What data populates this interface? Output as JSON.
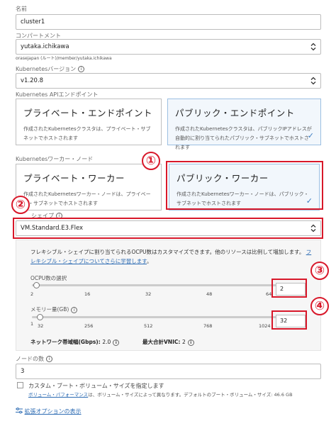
{
  "name": {
    "label": "名前",
    "value": "cluster1"
  },
  "compartment": {
    "label": "コンパートメント",
    "value": "yutaka.ichikawa",
    "path": "orasejapan (ルート)/member/yutaka.ichikawa"
  },
  "k8s_version": {
    "label": "Kubernetesバージョン",
    "value": "v1.20.8"
  },
  "api_endpoint": {
    "label": "Kubernetes APIエンドポイント",
    "options": [
      {
        "title": "プライベート・エンドポイント",
        "desc": "作成されたKubernetesクラスタは、プライベート・サブネットでホストされます",
        "selected": false
      },
      {
        "title": "パブリック・エンドポイント",
        "desc": "作成されたKubernetesクラスタは、パブリックIPアドレスが自動的に割り当てられたパブリック・サブネットでホストされます",
        "selected": true
      }
    ]
  },
  "worker_nodes": {
    "label": "Kubernetesワーカー・ノード",
    "options": [
      {
        "title": "プライベート・ワーカー",
        "desc": "作成されたKubernetesワーカー・ノードは、プライベート・サブネットでホストされます",
        "selected": false
      },
      {
        "title": "パブリック・ワーカー",
        "desc": "作成されたKubernetesワーカー・ノードは、パブリック・サブネットでホストされます",
        "selected": true
      }
    ]
  },
  "shape": {
    "label": "シェイプ",
    "value": "VM.Standard.E3.Flex"
  },
  "flex": {
    "desc": "フレキシブル・シェイプに割り当てられるOCPU数はカスタマイズできます。他のリソースは比例して増加します。",
    "link": "フレキシブル・シェイプについてさらに学習します",
    "period": "。",
    "ocpu": {
      "label": "OCPU数の選択",
      "ticks": [
        "1",
        "16",
        "32",
        "48",
        "64"
      ],
      "start_tick": "2",
      "value": "2",
      "level_fraction": 0.016
    },
    "memory": {
      "label": "メモリー量(GB)",
      "ticks": [
        "1",
        "32",
        "256",
        "512",
        "768",
        "1024"
      ],
      "value": "32",
      "level_fraction": 0.03
    },
    "bandwidth_label": "ネットワーク帯域幅(Gbps):",
    "bandwidth_value": "2.0",
    "vnic_label": "最大合計VNIC:",
    "vnic_value": "2"
  },
  "node_count": {
    "label": "ノードの数",
    "value": "3"
  },
  "boot_volume": {
    "label": "カスタム・ブート・ボリューム・サイズを指定します",
    "link": "ボリューム・パフォーマンス",
    "note": "は、ボリューム・サイズによって異なります。デフォルトのブート・ボリューム・サイズ: 46.6 GB"
  },
  "advanced": "拡張オプションの表示",
  "callouts": [
    "①",
    "②",
    "③",
    "④"
  ],
  "colors": {
    "callout_red": "#d8182a",
    "selected_bg": "#f2f7fc",
    "link_blue": "#2c6bb3"
  }
}
